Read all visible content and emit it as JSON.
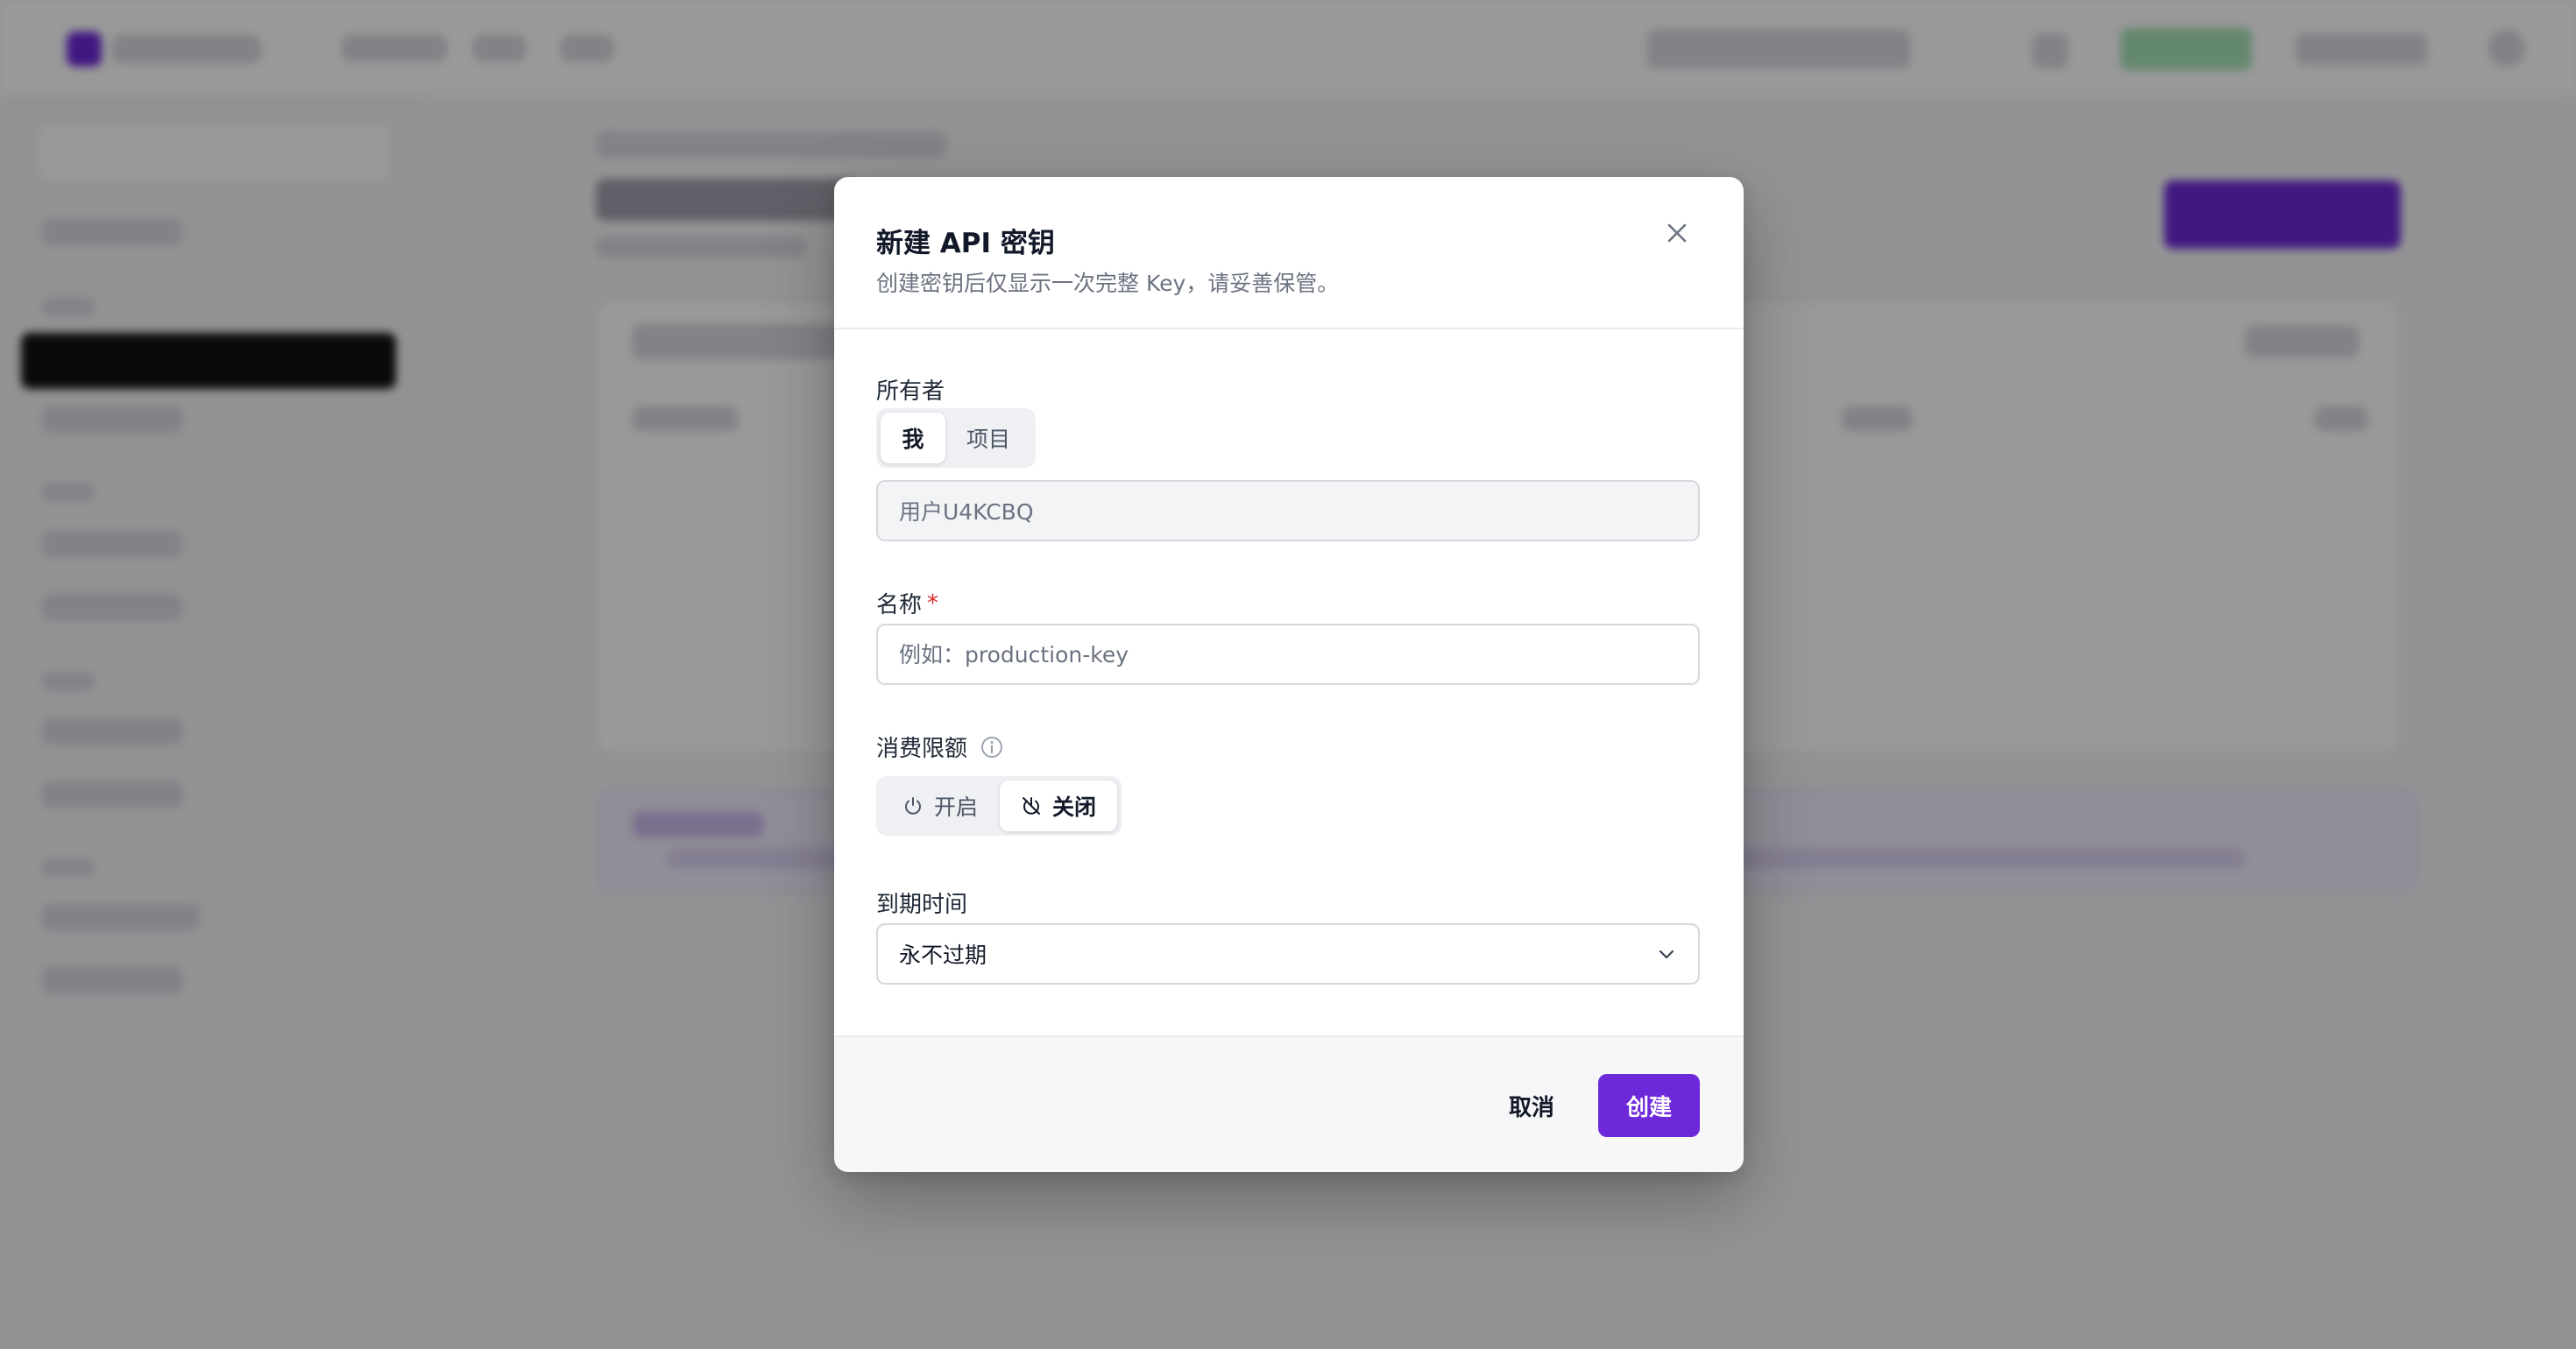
{
  "modal": {
    "title": "新建 API 密钥",
    "subtitle": "创建密钥后仅显示一次完整 Key，请妥善保管。"
  },
  "owner": {
    "label": "所有者",
    "options": [
      "我",
      "项目"
    ],
    "selected": "我",
    "value": "用户U4KCBQ"
  },
  "name": {
    "label": "名称",
    "required_mark": "*",
    "placeholder": "例如：production-key",
    "value": ""
  },
  "spend_limit": {
    "label": "消费限额",
    "info_icon": "info-icon",
    "options": [
      {
        "label": "开启",
        "icon": "power-icon"
      },
      {
        "label": "关闭",
        "icon": "power-off-icon"
      }
    ],
    "selected": "关闭"
  },
  "expiry": {
    "label": "到期时间",
    "value": "永不过期",
    "icon": "chevron-down-icon"
  },
  "footer": {
    "cancel_label": "取消",
    "create_label": "创建"
  },
  "colors": {
    "accent": "#6d28d9",
    "required": "#dc2626",
    "muted_text": "#6b7280"
  }
}
